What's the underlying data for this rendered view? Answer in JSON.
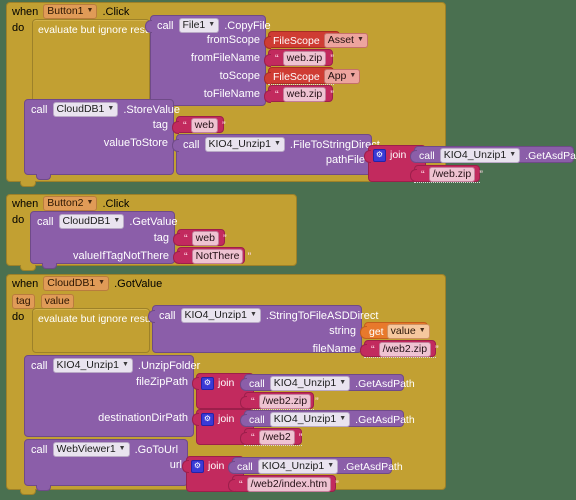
{
  "editor": {
    "name": "app-inventor-blocks-editor",
    "background_color": "#4a7050",
    "palette": {
      "event_block": "#c2a032",
      "method_block": "#8b5ea9",
      "text_block": "#c22a5e",
      "helper_block": "#cf3c33",
      "variable_block": "#e8792c",
      "mutator_icon": "#3a3ad6"
    }
  },
  "blocks": [
    {
      "id": "button1-click",
      "type": "event",
      "when": "when",
      "component": "Button1",
      "event": ".Click",
      "do_label": "do",
      "body": [
        {
          "id": "evaluate-but-ignore-1",
          "label": "evaluate but ignore result",
          "value": {
            "id": "file1-copyfile",
            "call": "call",
            "component": "File1",
            "method": ".CopyFile",
            "args": [
              {
                "name": "fromScope",
                "value_kind": "helper",
                "helper": "FileScope",
                "option": "Asset"
              },
              {
                "name": "fromFileName",
                "value_kind": "text",
                "text": "web.zip"
              },
              {
                "name": "toScope",
                "value_kind": "helper",
                "helper": "FileScope",
                "option": "App"
              },
              {
                "name": "toFileName",
                "value_kind": "text",
                "text": "web.zip"
              }
            ]
          }
        },
        {
          "id": "clouddb1-storevalue",
          "call": "call",
          "component": "CloudDB1",
          "method": ".StoreValue",
          "args": [
            {
              "name": "tag",
              "value_kind": "text",
              "text": "web"
            },
            {
              "name": "valueToStore",
              "value_kind": "call",
              "call": {
                "call": "call",
                "component": "KIO4_Unzip1",
                "method": ".FileToStringDirect",
                "args": [
                  {
                    "name": "pathFile",
                    "value_kind": "join",
                    "join": {
                      "label": "join",
                      "items": [
                        {
                          "kind": "call",
                          "call": "call",
                          "component": "KIO4_Unzip1",
                          "method": ".GetAsdPath"
                        },
                        {
                          "kind": "text",
                          "text": "/web.zip"
                        }
                      ]
                    }
                  }
                ]
              }
            }
          ]
        }
      ]
    },
    {
      "id": "button2-click",
      "type": "event",
      "when": "when",
      "component": "Button2",
      "event": ".Click",
      "do_label": "do",
      "body": [
        {
          "id": "clouddb1-getvalue",
          "call": "call",
          "component": "CloudDB1",
          "method": ".GetValue",
          "args": [
            {
              "name": "tag",
              "value_kind": "text",
              "text": "web"
            },
            {
              "name": "valueIfTagNotThere",
              "value_kind": "text",
              "text": "NotThere"
            }
          ]
        }
      ]
    },
    {
      "id": "clouddb1-gotvalue",
      "type": "event",
      "when": "when",
      "component": "CloudDB1",
      "event": ".GotValue",
      "params": [
        "tag",
        "value"
      ],
      "do_label": "do",
      "body": [
        {
          "id": "evaluate-but-ignore-2",
          "label": "evaluate but ignore result",
          "value": {
            "id": "stringtofileasddirect",
            "call": "call",
            "component": "KIO4_Unzip1",
            "method": ".StringToFileASDDirect",
            "args": [
              {
                "name": "string",
                "value_kind": "get",
                "get_label": "get",
                "variable": "value"
              },
              {
                "name": "fileName",
                "value_kind": "text",
                "text": "/web2.zip"
              }
            ]
          }
        },
        {
          "id": "unzipfolder",
          "call": "call",
          "component": "KIO4_Unzip1",
          "method": ".UnzipFolder",
          "args": [
            {
              "name": "fileZipPath",
              "value_kind": "join",
              "join": {
                "label": "join",
                "items": [
                  {
                    "kind": "call",
                    "call": "call",
                    "component": "KIO4_Unzip1",
                    "method": ".GetAsdPath"
                  },
                  {
                    "kind": "text",
                    "text": "/web2.zip"
                  }
                ]
              }
            },
            {
              "name": "destinationDirPath",
              "value_kind": "join",
              "join": {
                "label": "join",
                "items": [
                  {
                    "kind": "call",
                    "call": "call",
                    "component": "KIO4_Unzip1",
                    "method": ".GetAsdPath"
                  },
                  {
                    "kind": "text",
                    "text": "/web2"
                  }
                ]
              }
            }
          ]
        },
        {
          "id": "webviewer1-gotourl",
          "call": "call",
          "component": "WebViewer1",
          "method": ".GoToUrl",
          "args": [
            {
              "name": "url",
              "value_kind": "join",
              "join": {
                "label": "join",
                "items": [
                  {
                    "kind": "call",
                    "call": "call",
                    "component": "KIO4_Unzip1",
                    "method": ".GetAsdPath"
                  },
                  {
                    "kind": "text",
                    "text": "/web2/index.htm"
                  }
                ]
              }
            }
          ]
        }
      ]
    }
  ]
}
